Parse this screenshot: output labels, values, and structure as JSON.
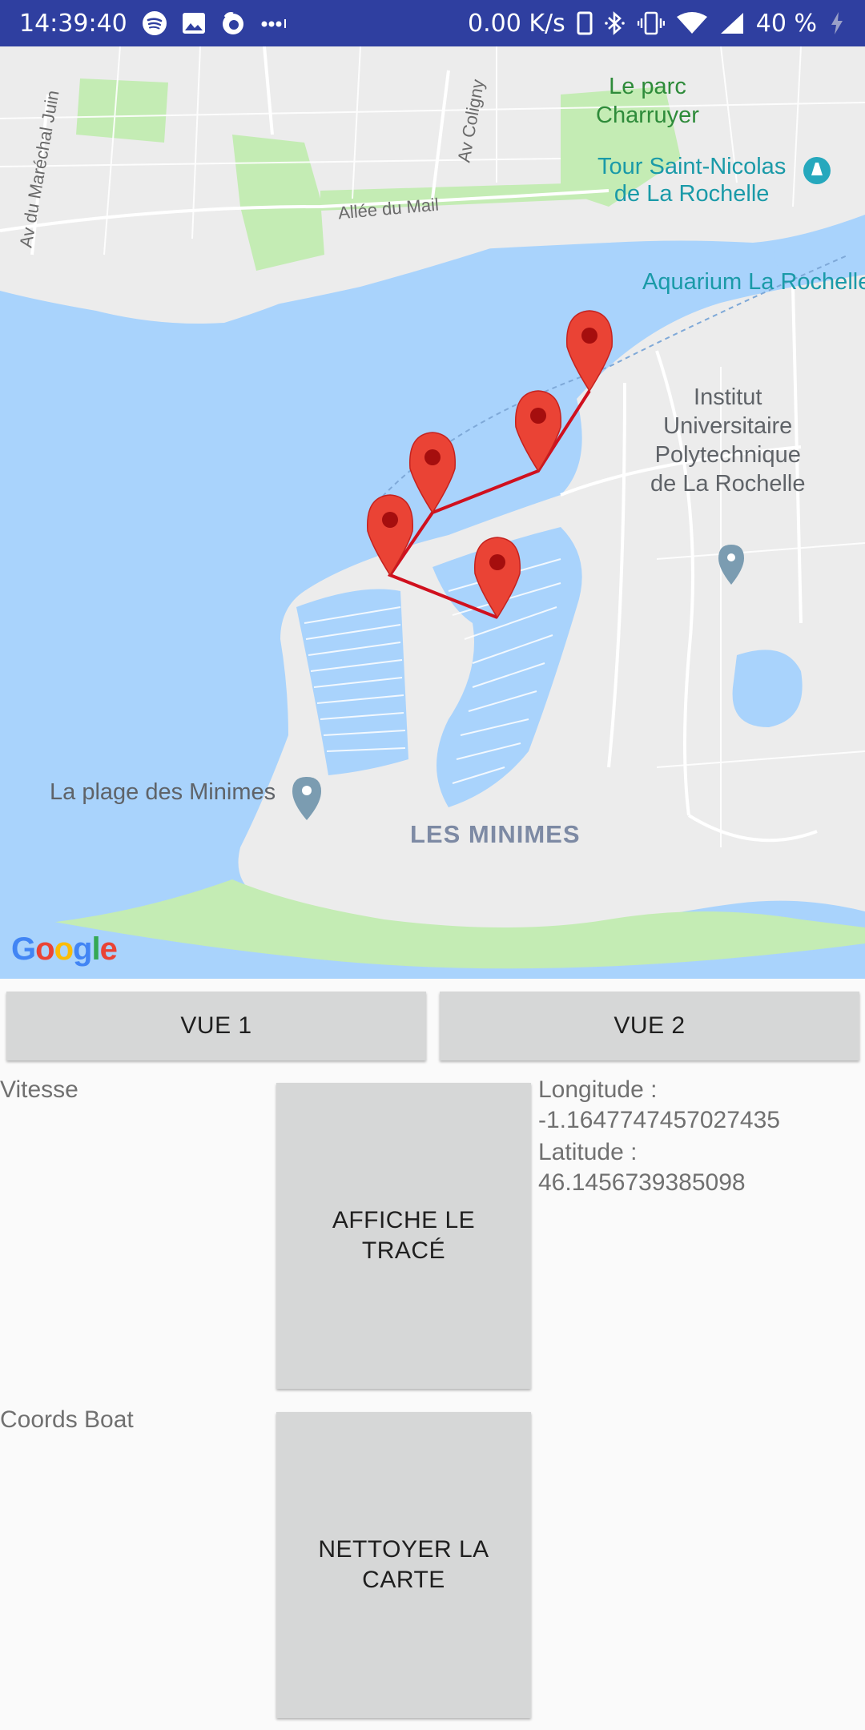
{
  "status_bar": {
    "time": "14:39:40",
    "network_speed": "0.00 K/s",
    "battery_percent": "40 %",
    "icons": [
      "spotify-icon",
      "gallery-icon",
      "firefox-icon",
      "more-dots-icon",
      "sim-icon",
      "bluetooth-icon",
      "vibrate-icon",
      "wifi-icon",
      "signal-icon",
      "battery-charging-icon"
    ]
  },
  "map": {
    "labels": {
      "park": "Le parc\nCharruyer",
      "tower": "Tour Saint-Nicolas\nde La Rochelle",
      "aquarium": "Aquarium La Rochelle",
      "institute": "Institut\nUniversitaire\nPolytechnique\nde La Rochelle",
      "beach": "La plage des Minimes",
      "district": "LES MINIMES",
      "road_mail": "Allée du Mail",
      "road_juin": "Av du Maréchal Juin",
      "road_coligny": "Av Coligny"
    },
    "logo": "Google",
    "markers_count": 5,
    "route_color": "#d0101e",
    "marker_color": "#ea4335"
  },
  "buttons": {
    "vue1": "VUE 1",
    "vue2": "VUE 2",
    "trace": "AFFICHE LE TRACÉ",
    "clean": "NETTOYER LA CARTE"
  },
  "info": {
    "speed_label": "Vitesse",
    "coords_label": "Coords Boat",
    "longitude_label": "Longitude :",
    "longitude_value": "-1.1647747457027435",
    "latitude_label": "Latitude :",
    "latitude_value": "46.1456739385098"
  }
}
